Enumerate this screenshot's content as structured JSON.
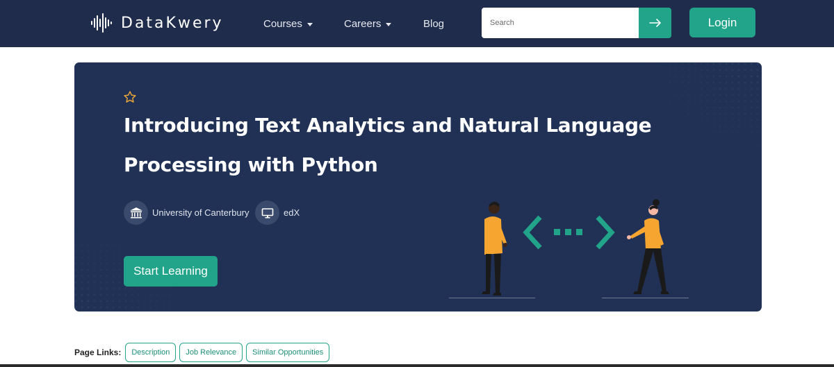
{
  "navbar": {
    "brand": "DataKwery",
    "items": [
      {
        "label": "Courses",
        "dropdown": true
      },
      {
        "label": "Careers",
        "dropdown": true
      },
      {
        "label": "Blog",
        "dropdown": false
      }
    ],
    "search": {
      "placeholder": "Search",
      "value": ""
    },
    "login_label": "Login"
  },
  "hero": {
    "title": "Introducing Text Analytics and Natural Language Processing with Python",
    "institution": "University of Canterbury",
    "platform": "edX",
    "start_label": "Start Learning",
    "icons": [
      "star-icon",
      "institution-icon",
      "monitor-icon"
    ]
  },
  "page_links": {
    "label": "Page Links:",
    "links": [
      "Description",
      "Job Relevance",
      "Similar Opportunities"
    ]
  },
  "colors": {
    "navbar": "#1f2c4b",
    "hero_bg": "#203155",
    "accent": "#21a48a",
    "star": "#e8a43a"
  }
}
